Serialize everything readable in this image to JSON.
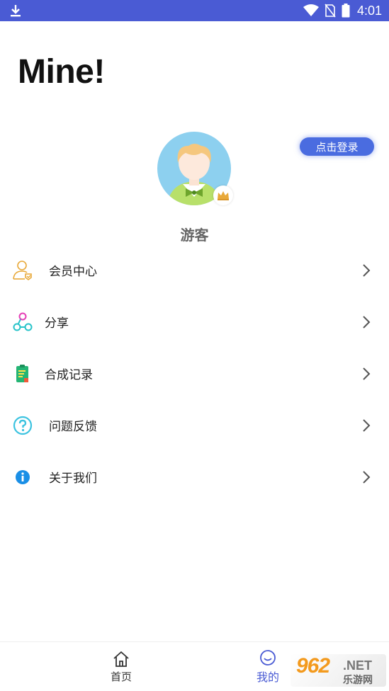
{
  "status_bar": {
    "time": "4:01"
  },
  "page": {
    "title": "Mine!"
  },
  "profile": {
    "login_button": "点击登录",
    "username": "游客"
  },
  "menu": {
    "items": [
      {
        "label": "会员中心",
        "icon": "member-icon"
      },
      {
        "label": "分享",
        "icon": "share-icon"
      },
      {
        "label": "合成记录",
        "icon": "record-icon"
      },
      {
        "label": "问题反馈",
        "icon": "question-icon"
      },
      {
        "label": "关于我们",
        "icon": "info-icon"
      }
    ]
  },
  "bottom_nav": {
    "home_label": "首页",
    "mine_label": "我的"
  },
  "watermark": {
    "number": "962",
    "suffix": ".NET",
    "site": "乐游网"
  },
  "colors": {
    "accent": "#4a5bd4",
    "login_button": "#4a6ce0",
    "avatar_bg": "#8dd0ef"
  }
}
